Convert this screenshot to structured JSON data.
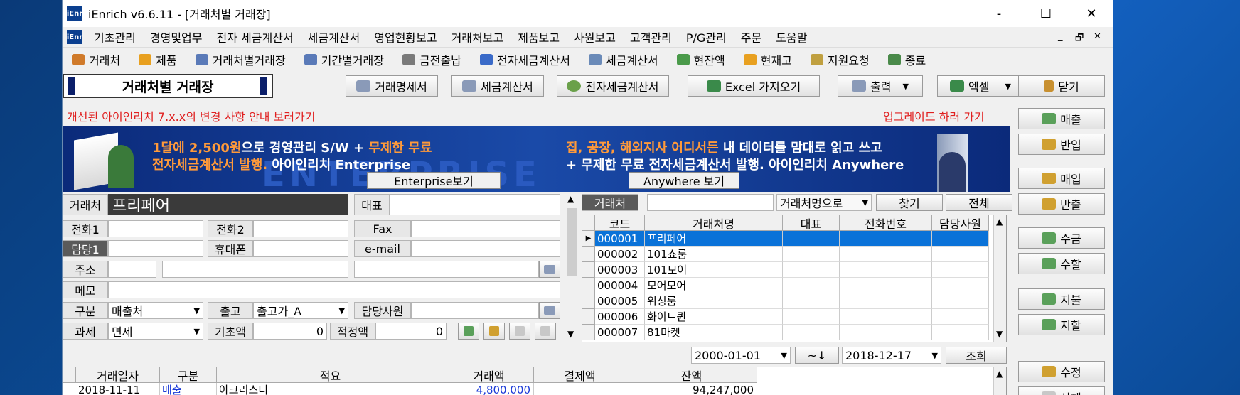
{
  "window": {
    "title": "iEnrich v6.6.11 - [거래처별 거래장]",
    "logo": "iEnr",
    "min": "-",
    "max": "☐",
    "close": "✕",
    "mdi_min": "_",
    "mdi_restore": "🗗",
    "mdi_close": "✕"
  },
  "menu": [
    "기초관리",
    "경영및업무",
    "전자 세금계산서",
    "세금계산서",
    "영업현황보고",
    "거래처보고",
    "제품보고",
    "사원보고",
    "고객관리",
    "P/G관리",
    "주문",
    "도움말"
  ],
  "toolbar": [
    {
      "label": "거래처",
      "icon": "person-icon",
      "color": "#d07a2a"
    },
    {
      "label": "제품",
      "icon": "star-icon",
      "color": "#e8a020"
    },
    {
      "label": "거래처별거래장",
      "icon": "ledger-icon",
      "color": "#5a7ab8"
    },
    {
      "label": "기간별거래장",
      "icon": "calendar-icon",
      "color": "#5a7ab8"
    },
    {
      "label": "금전출납",
      "icon": "cash-icon",
      "color": "#7a7a7a"
    },
    {
      "label": "전자세금계산서",
      "icon": "html-icon",
      "color": "#3a6ac8"
    },
    {
      "label": "세금계산서",
      "icon": "doc-icon",
      "color": "#6a8ab8"
    },
    {
      "label": "현잔액",
      "icon": "money-icon",
      "color": "#4a9a4a"
    },
    {
      "label": "현재고",
      "icon": "box-icon",
      "color": "#e8a020"
    },
    {
      "label": "지원요청",
      "icon": "support-icon",
      "color": "#c0a040"
    },
    {
      "label": "종료",
      "icon": "exit-icon",
      "color": "#4a8a4a"
    }
  ],
  "page_title": "거래처별 거래장",
  "actions": {
    "stmt": "거래명세서",
    "tax": "세금계산서",
    "etax": "전자세금계산서",
    "excel_import": "Excel 가져오기",
    "print": "출력",
    "excel": "엑셀",
    "close": "닫기"
  },
  "notice": {
    "left": "개선된 아이인리치 7.x.x의 변경 사항 안내 보러가기",
    "right": "업그레이드 하러 가기"
  },
  "banner": {
    "line1a": "1달에 2,500원",
    "line1b": "으로 경영관리 S/W + ",
    "line1c": "무제한 무료",
    "line2a": "전자세금계산서 발행.",
    "line2b": " 아이인리치 Enterprise",
    "btn_enterprise": "Enterprise보기",
    "line3a": "집, 공장, 해외지사 어디서든",
    "line3b": " 내 데이터를 맘대로 읽고 쓰고",
    "line4a": "+ 무제한 무료 전자세금계산서 발행.",
    "line4b": " 아이인리치 Anywhere",
    "btn_anywhere": "Anywhere 보기",
    "bg_text": "ENTERPRISE"
  },
  "form": {
    "client_label": "거래처",
    "client_value": "프리페어",
    "rep_label": "대표",
    "phone1_label": "전화1",
    "phone2_label": "전화2",
    "fax_label": "Fax",
    "manager1_label": "담당1",
    "mobile_label": "휴대폰",
    "email_label": "e-mail",
    "address_label": "주소",
    "memo_label": "메모",
    "type_label": "구분",
    "type_value": "매출처",
    "release_label": "출고",
    "release_value": "출고가_A",
    "staff_label": "담당사원",
    "tax_label": "과세",
    "tax_value": "면세",
    "base_label": "기초액",
    "base_value": "0",
    "proper_label": "적정액",
    "proper_value": "0"
  },
  "search": {
    "label": "거래처",
    "mode": "거래처명으로",
    "find": "찾기",
    "all": "전체"
  },
  "client_table": {
    "headers": [
      "코드",
      "거래처명",
      "대표",
      "전화번호",
      "담당사원"
    ],
    "rows": [
      [
        "000001",
        "프리페어",
        "",
        "",
        ""
      ],
      [
        "000002",
        "101쇼룸",
        "",
        "",
        ""
      ],
      [
        "000003",
        "101모어",
        "",
        "",
        ""
      ],
      [
        "000004",
        "모어모어",
        "",
        "",
        ""
      ],
      [
        "000005",
        "워싱룸",
        "",
        "",
        ""
      ],
      [
        "000006",
        "화이트퀸",
        "",
        "",
        ""
      ],
      [
        "000007",
        "81마켓",
        "",
        "",
        ""
      ]
    ]
  },
  "period": {
    "from": "2000-01-01",
    "arrow": "~↓",
    "to": "2018-12-17",
    "query": "조회"
  },
  "ledger": {
    "headers": [
      "거래일자",
      "구분",
      "적요",
      "거래액",
      "결제액",
      "잔액"
    ],
    "rows": [
      [
        "2018-11-11",
        "매출",
        "아크리스티",
        "4,800,000",
        "",
        "94,247,000"
      ]
    ]
  },
  "right_buttons": [
    {
      "label": "매출",
      "icon": "sale-icon"
    },
    {
      "label": "반입",
      "icon": "return-icon"
    },
    {
      "label": "매입",
      "icon": "purchase-icon"
    },
    {
      "label": "반출",
      "icon": "ship-out-icon"
    },
    {
      "label": "수금",
      "icon": "collect-icon"
    },
    {
      "label": "수할",
      "icon": "collect-discount-icon"
    },
    {
      "label": "지불",
      "icon": "pay-icon"
    },
    {
      "label": "지할",
      "icon": "pay-discount-icon"
    },
    {
      "label": "수정",
      "icon": "edit-icon"
    },
    {
      "label": "삭제",
      "icon": "delete-icon"
    }
  ]
}
